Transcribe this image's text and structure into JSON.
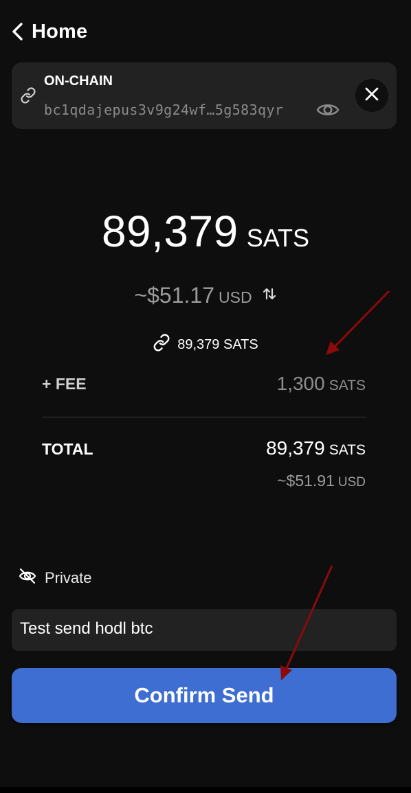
{
  "header": {
    "back_icon": "chevron-left-icon",
    "title": "Home"
  },
  "destination": {
    "type": "ON-CHAIN",
    "address": "bc1qdajepus3v9g24wf…5g583qyr",
    "icons": {
      "link": "link-icon",
      "reveal": "eye-icon",
      "close": "close-icon"
    }
  },
  "amount": {
    "value": "89,379",
    "unit": "SATS"
  },
  "fiat": {
    "value": "~$51.17",
    "currency": "USD",
    "swap_icon": "swap-vertical-icon"
  },
  "onchain_amount": {
    "icon": "link-icon",
    "text": "89,379 SATS"
  },
  "fee": {
    "label": "+ FEE",
    "value": "1,300",
    "unit": "SATS"
  },
  "total": {
    "label": "TOTAL",
    "value": "89,379",
    "unit": "SATS",
    "fiat_value": "~$51.91",
    "fiat_currency": "USD"
  },
  "privacy": {
    "icon": "eye-off-icon",
    "label": "Private"
  },
  "note": {
    "value": "Test send hodl btc"
  },
  "confirm_button": {
    "label": "Confirm Send"
  },
  "colors": {
    "background": "#0e0e0e",
    "card": "#222222",
    "accent_button": "#3e6ed1",
    "muted_text": "#9c9c9c",
    "annotation_arrow": "#8b0a0a"
  }
}
